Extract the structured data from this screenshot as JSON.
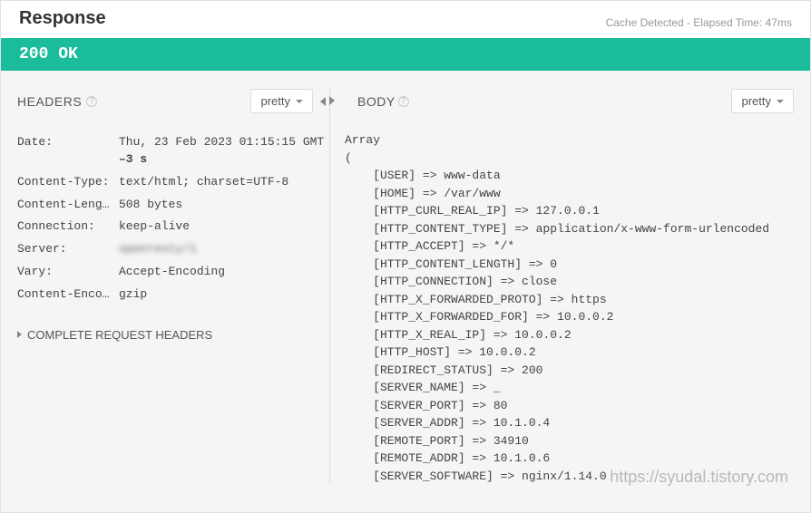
{
  "header": {
    "title": "Response",
    "meta": "Cache Detected - Elapsed Time: 47ms"
  },
  "status": "200 OK",
  "headers_section": {
    "title": "HEADERS",
    "pretty_label": "pretty",
    "rows": [
      {
        "key": "Date:",
        "val": "Thu, 23 Feb 2023 01:15:15 GMT",
        "age": " –3 s"
      },
      {
        "key": "Content-Type:",
        "val": "text/html; charset=UTF-8"
      },
      {
        "key": "Content-Leng…",
        "val": "508 bytes"
      },
      {
        "key": "Connection:",
        "val": "keep-alive"
      },
      {
        "key": "Server:",
        "val": "openresty/1",
        "blur": true
      },
      {
        "key": "Vary:",
        "val": "Accept-Encoding"
      },
      {
        "key": "Content-Enco…",
        "val": "gzip"
      }
    ],
    "complete_label": "COMPLETE REQUEST HEADERS"
  },
  "body_section": {
    "title": "BODY",
    "pretty_label": "pretty",
    "lines": [
      "Array",
      "(",
      "    [USER] => www-data",
      "    [HOME] => /var/www",
      "    [HTTP_CURL_REAL_IP] => 127.0.0.1",
      "    [HTTP_CONTENT_TYPE] => application/x-www-form-urlencoded",
      "    [HTTP_ACCEPT] => */*",
      "    [HTTP_CONTENT_LENGTH] => 0",
      "    [HTTP_CONNECTION] => close",
      "    [HTTP_X_FORWARDED_PROTO] => https",
      "    [HTTP_X_FORWARDED_FOR] => 10.0.0.2",
      "    [HTTP_X_REAL_IP] => 10.0.0.2",
      "    [HTTP_HOST] => 10.0.0.2",
      "    [REDIRECT_STATUS] => 200",
      "    [SERVER_NAME] => _",
      "    [SERVER_PORT] => 80",
      "    [SERVER_ADDR] => 10.1.0.4",
      "    [REMOTE_PORT] => 34910",
      "    [REMOTE_ADDR] => 10.1.0.6",
      "    [SERVER_SOFTWARE] => nginx/1.14.0"
    ]
  },
  "watermark": "https://syudal.tistory.com"
}
